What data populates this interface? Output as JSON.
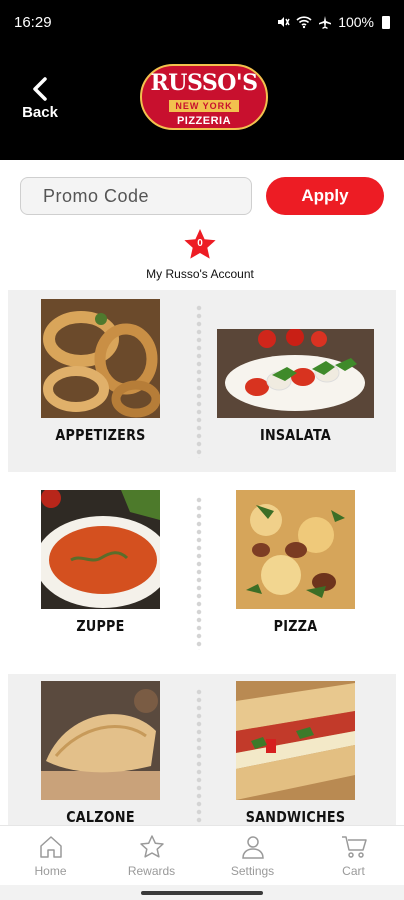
{
  "status_bar": {
    "time": "16:29",
    "battery": "100%",
    "icons": [
      "mute-icon",
      "wifi-icon",
      "airplane-icon",
      "battery-icon"
    ]
  },
  "header": {
    "back_label": "Back",
    "logo": {
      "name": "RUSSO'S",
      "band": "NEW YORK",
      "sub": "PIZZERIA"
    }
  },
  "promo": {
    "placeholder": "Promo Code",
    "value": "",
    "apply_label": "Apply"
  },
  "account": {
    "count": "0",
    "label": "My Russo's Account"
  },
  "menu": {
    "categories": [
      {
        "label": "APPETIZERS"
      },
      {
        "label": "INSALATA"
      },
      {
        "label": "ZUPPE"
      },
      {
        "label": "PIZZA"
      },
      {
        "label": "CALZONE"
      },
      {
        "label": "SANDWICHES"
      }
    ]
  },
  "bottom_nav": {
    "items": [
      {
        "label": "Home",
        "icon": "home-icon"
      },
      {
        "label": "Rewards",
        "icon": "star-icon"
      },
      {
        "label": "Settings",
        "icon": "person-icon"
      },
      {
        "label": "Cart",
        "icon": "cart-icon"
      }
    ]
  },
  "colors": {
    "brand_red": "#ed1c24",
    "logo_gold": "#f2c14e",
    "header_bg": "#000000",
    "nav_inactive": "#9a9a9a"
  }
}
